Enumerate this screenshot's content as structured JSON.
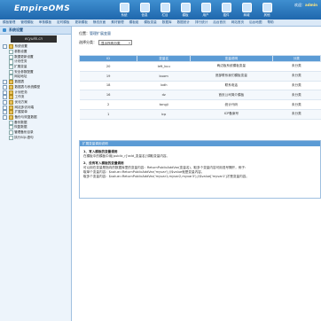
{
  "header": {
    "logo_main": "EmpireOMS",
    "welcome_prefix": "欢迎：",
    "welcome_user": "admin",
    "icons": [
      {
        "name": "system-icon",
        "label": "系统"
      },
      {
        "name": "info-icon",
        "label": "信息"
      },
      {
        "name": "column-icon",
        "label": "栏目"
      },
      {
        "name": "template-icon",
        "label": "模板"
      },
      {
        "name": "user-icon",
        "label": "用户"
      },
      {
        "name": "plugin-icon",
        "label": "插件"
      },
      {
        "name": "commerce-icon",
        "label": "商城"
      },
      {
        "name": "other-icon",
        "label": "其他"
      }
    ]
  },
  "navbar": {
    "items": [
      "模板管理",
      "管理模板",
      "审核模板",
      "定时模板",
      "更新模板",
      "静态页面",
      "素材管理",
      "模板组",
      "模板变量",
      "数据库",
      "数据统计",
      "排行统计",
      "后台首页",
      "网站首页",
      "后台地图",
      "帮助"
    ]
  },
  "sidebar": {
    "title": "系统设置",
    "watermark": "ecyukk.cn",
    "tree": [
      {
        "label": "系统设置",
        "type": "folder",
        "level": 0
      },
      {
        "label": "参数设置",
        "type": "page",
        "level": 1
      },
      {
        "label": "数据更新设置",
        "type": "page",
        "level": 1
      },
      {
        "label": "计划任务",
        "type": "page",
        "level": 1
      },
      {
        "label": "扩展变量",
        "type": "page",
        "level": 1
      },
      {
        "label": "安全参数配置",
        "type": "page",
        "level": 1
      },
      {
        "label": "网站地址",
        "type": "page",
        "level": 1
      },
      {
        "label": "数据表",
        "type": "folder",
        "level": 0
      },
      {
        "label": "数据表与系统模型",
        "type": "folder",
        "level": 0
      },
      {
        "label": "计划任务",
        "type": "folder",
        "level": 0
      },
      {
        "label": "工作流",
        "type": "folder",
        "level": 0
      },
      {
        "label": "优化方案",
        "type": "folder",
        "level": 0
      },
      {
        "label": "网站多访问端",
        "type": "folder",
        "level": 0
      },
      {
        "label": "扩展菜单",
        "type": "folder",
        "level": 0
      },
      {
        "label": "备份与恢复数据",
        "type": "folder",
        "level": 0
      },
      {
        "label": "备份数据",
        "type": "page",
        "level": 1
      },
      {
        "label": "恢复数据",
        "type": "page",
        "level": 1
      },
      {
        "label": "管理备份目录",
        "type": "page",
        "level": 1
      },
      {
        "label": "执行SQL语句",
        "type": "page",
        "level": 1
      }
    ]
  },
  "main": {
    "breadcrumb_prefix": "位置：",
    "breadcrumb_link": "管理扩展变量",
    "filter_label": "选择分类：",
    "filter_value": "显示所有分类",
    "columns": [
      "ID",
      "变量名",
      "变量说明",
      "分类"
    ],
    "rows": [
      {
        "id": "20",
        "name": "left_kuu",
        "desc": "两边板系统模板变量",
        "cat": "未分类"
      },
      {
        "id": "19",
        "name": "buom",
        "desc": "底部联系我们模板变量",
        "cat": "未分类"
      },
      {
        "id": "18",
        "name": "lxdh",
        "desc": "联系电话",
        "cat": "未分类"
      },
      {
        "id": "16",
        "name": "dz",
        "desc": "首页公司简介模板",
        "cat": "未分类"
      },
      {
        "id": "2",
        "name": "tongji",
        "desc": "统计代码",
        "cat": "未分类"
      },
      {
        "id": "1",
        "name": "icp",
        "desc": "ICP备案号",
        "cat": "未分类"
      }
    ],
    "help": {
      "title": "扩展变量调用说明",
      "h1": "1、写入模板的变量调用",
      "p1": "在模板中的模板中用[public_r]'add_变量名]'调取变量内容。",
      "h2": "2、没有写入模板的变量调用",
      "p2": "可以用在变量是指向的数据库里的变量内容：ReturnPublicAddVar(变量名)，取多个变量内容可用逗号隔开，例子：",
      "p3": "取单个变量内容：$value=ReturnPublicAddVar('myvar');//$value就是变量内容。",
      "p4": "取多个变量内容：$value=ReturnPublicAddVar('myvar1,myvar2,myvar3');//$value['myvar1']才是变量内容。"
    }
  }
}
